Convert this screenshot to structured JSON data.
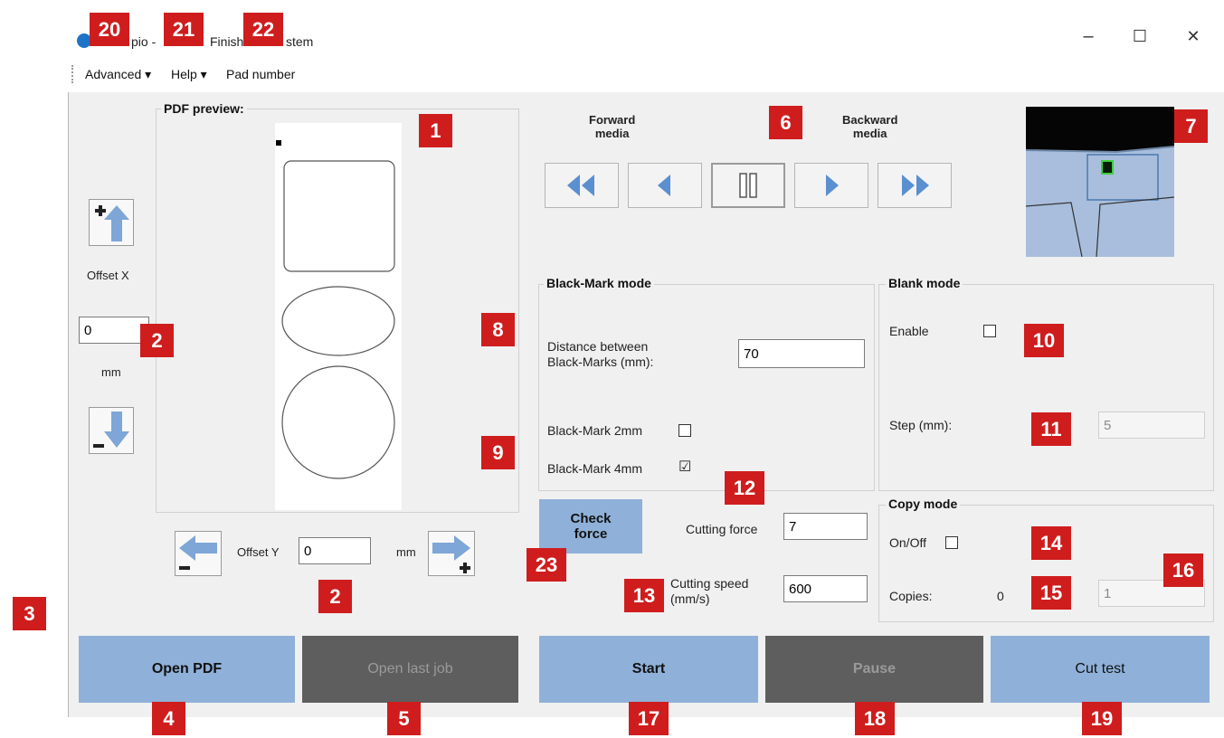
{
  "window": {
    "title_parts": [
      "pio -",
      "Finish",
      "stem"
    ],
    "controls": {
      "minimize": "–",
      "maximize": "☐",
      "close": "✕"
    }
  },
  "menu": [
    "Advanced ▾",
    "Help ▾",
    "Pad number"
  ],
  "pdf_preview": {
    "label": "PDF preview:"
  },
  "offset_x": {
    "label": "Offset X",
    "value": "0",
    "unit": "mm"
  },
  "offset_y": {
    "label": "Offset Y",
    "value": "0",
    "unit": "mm"
  },
  "media": {
    "forward_label": "Forward\nmedia",
    "backward_label": "Backward\nmedia"
  },
  "black_mark": {
    "title": "Black-Mark mode",
    "distance_label": "Distance between\nBlack-Marks (mm):",
    "distance_value": "70",
    "mark2_label": "Black-Mark 2mm",
    "mark2_checked": "",
    "mark4_label": "Black-Mark 4mm",
    "mark4_checked": "☑"
  },
  "blank_mode": {
    "title": "Blank mode",
    "enable_label": "Enable",
    "step_label": "Step (mm):",
    "step_value": "5"
  },
  "force": {
    "check_label": "Check\nforce",
    "cutting_force_label": "Cutting force",
    "cutting_force_value": "7",
    "cutting_speed_label": "Cutting speed\n(mm/s)",
    "cutting_speed_value": "600"
  },
  "copy_mode": {
    "title": "Copy mode",
    "onoff_label": "On/Off",
    "copies_label": "Copies:",
    "copies_count": "0",
    "copies_value": "1"
  },
  "buttons": {
    "open_pdf": "Open PDF",
    "open_last_job": "Open last job",
    "start": "Start",
    "pause": "Pause",
    "cut_test": "Cut test"
  },
  "callouts": [
    "1",
    "2",
    "2",
    "3",
    "4",
    "5",
    "6",
    "7",
    "8",
    "9",
    "10",
    "11",
    "12",
    "13",
    "14",
    "15",
    "16",
    "17",
    "18",
    "19",
    "20",
    "21",
    "22",
    "23"
  ],
  "colors": {
    "callout": "#cf1d1d",
    "button_blue": "#8fb1d9",
    "button_gray": "#5e5e5e",
    "arrow_blue": "#7ea6d6",
    "camera_bg": "#a8bedc"
  }
}
